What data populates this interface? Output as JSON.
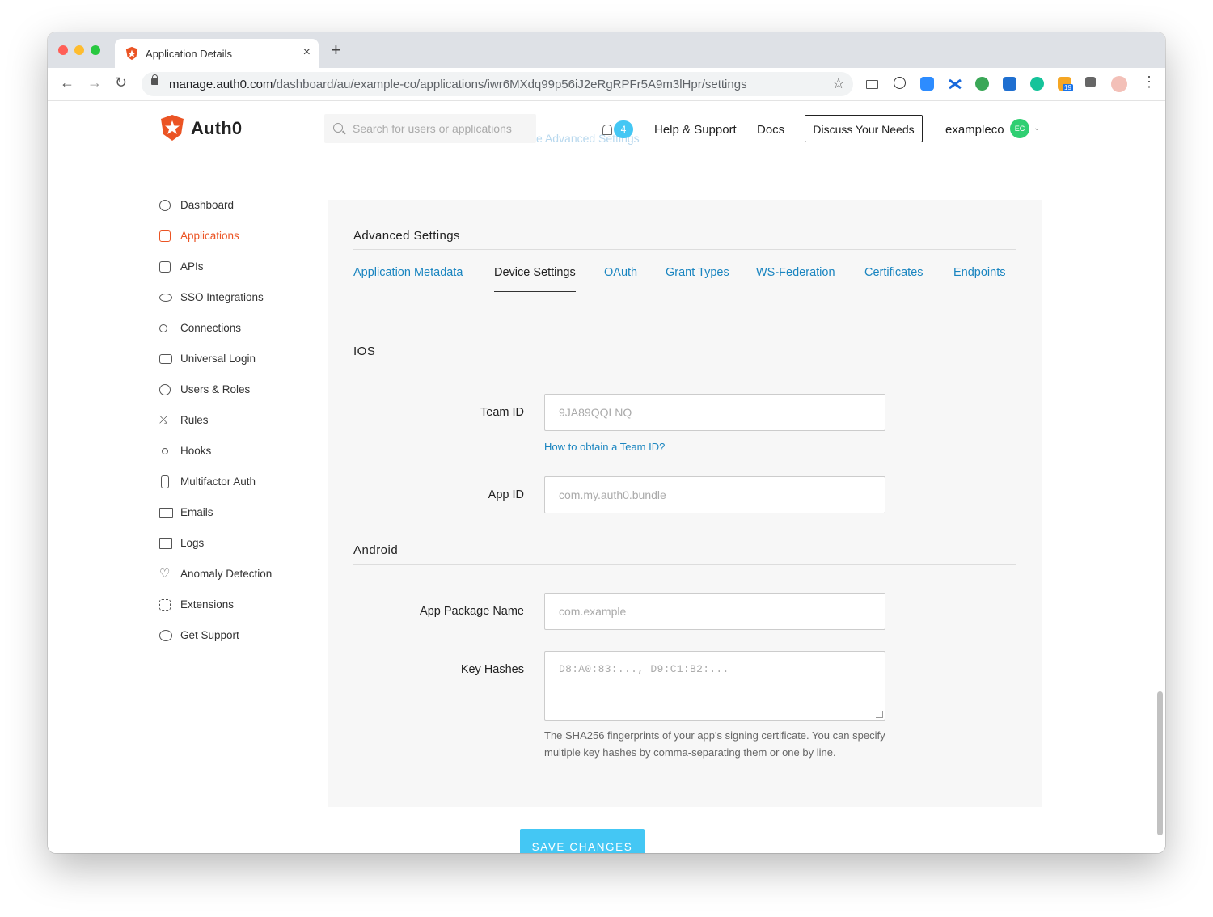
{
  "browser": {
    "tab_title": "Application Details",
    "tab_close": "×",
    "new_tab": "+",
    "url_host": "manage.auth0.com",
    "url_path": "/dashboard/au/example-co/applications/iwr6MXdq99p56iJ2eRgRPFr5A9m3lHpr/settings",
    "nav_back": "←",
    "nav_forward": "→",
    "nav_reload": "↻",
    "star": "☆",
    "menu": "⋮",
    "ext_badge": "19"
  },
  "header": {
    "brand": "Auth0",
    "search_placeholder": "Search for users or applications",
    "ghost_text": "e Advanced Settings",
    "notifications_count": "4",
    "help_support": "Help & Support",
    "docs": "Docs",
    "discuss": "Discuss Your Needs",
    "account": "exampleco",
    "avatar_initials": "EC",
    "caret": "⌄"
  },
  "sidebar": {
    "items": [
      {
        "label": "Dashboard",
        "icon": "dashboard-icon"
      },
      {
        "label": "Applications",
        "icon": "applications-icon",
        "active": true
      },
      {
        "label": "APIs",
        "icon": "apis-icon"
      },
      {
        "label": "SSO Integrations",
        "icon": "cloud-icon"
      },
      {
        "label": "Connections",
        "icon": "share-icon"
      },
      {
        "label": "Universal Login",
        "icon": "login-icon"
      },
      {
        "label": "Users & Roles",
        "icon": "users-icon"
      },
      {
        "label": "Rules",
        "icon": "shuffle-icon"
      },
      {
        "label": "Hooks",
        "icon": "hooks-icon"
      },
      {
        "label": "Multifactor Auth",
        "icon": "phone-icon"
      },
      {
        "label": "Emails",
        "icon": "mail-icon"
      },
      {
        "label": "Logs",
        "icon": "book-icon"
      },
      {
        "label": "Anomaly Detection",
        "icon": "heart-icon"
      },
      {
        "label": "Extensions",
        "icon": "chip-icon"
      },
      {
        "label": "Get Support",
        "icon": "chat-icon"
      }
    ]
  },
  "content": {
    "section_title": "Advanced Settings",
    "tabs": [
      {
        "label": "Application Metadata"
      },
      {
        "label": "Device Settings",
        "active": true
      },
      {
        "label": "OAuth"
      },
      {
        "label": "Grant Types"
      },
      {
        "label": "WS-Federation"
      },
      {
        "label": "Certificates"
      },
      {
        "label": "Endpoints"
      }
    ],
    "ios": {
      "heading": "IOS",
      "team_id_label": "Team ID",
      "team_id_placeholder": "9JA89QQLNQ",
      "team_id_help": "How to obtain a Team ID?",
      "app_id_label": "App ID",
      "app_id_placeholder": "com.my.auth0.bundle"
    },
    "android": {
      "heading": "Android",
      "package_label": "App Package Name",
      "package_placeholder": "com.example",
      "hashes_label": "Key Hashes",
      "hashes_placeholder": "D8:A0:83:..., D9:C1:B2:...",
      "hashes_help": "The SHA256 fingerprints of your app's signing certificate. You can specify multiple key hashes by comma-separating them or one by line."
    },
    "save_button": "SAVE CHANGES"
  },
  "colors": {
    "accent": "#eb5424",
    "link": "#1a85c0",
    "save": "#44c7f4"
  }
}
